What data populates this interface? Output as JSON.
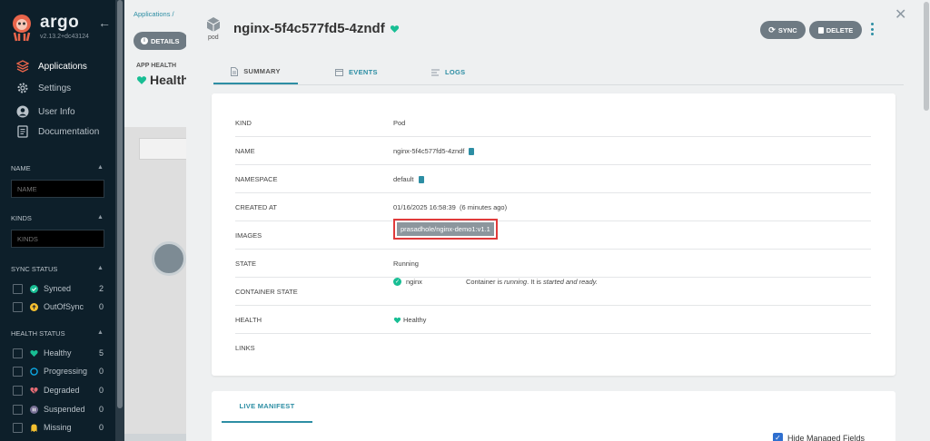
{
  "sidebar": {
    "brand": "argo",
    "version": "v2.13.2+dc43124",
    "nav": [
      {
        "label": "Applications",
        "icon": "layers-icon",
        "active": true
      },
      {
        "label": "Settings",
        "icon": "gear-icon"
      },
      {
        "label": "User Info",
        "icon": "user-icon"
      },
      {
        "label": "Documentation",
        "icon": "book-icon"
      }
    ],
    "name_title": "NAME",
    "name_placeholder": "NAME",
    "kinds_title": "KINDS",
    "kinds_placeholder": "KINDS",
    "sync_title": "SYNC STATUS",
    "sync_items": [
      {
        "label": "Synced",
        "count": "2",
        "icon": "check-circle-icon",
        "color": "#18be94"
      },
      {
        "label": "OutOfSync",
        "count": "0",
        "icon": "arrow-up-circle-icon",
        "color": "#f4c030"
      }
    ],
    "health_title": "HEALTH STATUS",
    "health_items": [
      {
        "label": "Healthy",
        "count": "5",
        "icon": "heart-icon",
        "color": "#18be94"
      },
      {
        "label": "Progressing",
        "count": "0",
        "icon": "circle-notch-icon",
        "color": "#0dadea"
      },
      {
        "label": "Degraded",
        "count": "0",
        "icon": "broken-heart-icon",
        "color": "#e96d76"
      },
      {
        "label": "Suspended",
        "count": "0",
        "icon": "pause-circle-icon",
        "color": "#766f94"
      },
      {
        "label": "Missing",
        "count": "0",
        "icon": "ghost-icon",
        "color": "#f4c030"
      }
    ]
  },
  "background": {
    "breadcrumb": "Applications /",
    "details_btn": "DETAILS",
    "app_health_label": "APP HEALTH",
    "app_health_value": "Health"
  },
  "panel": {
    "kind_icon_label": "pod",
    "title": "nginx-5f4c577fd5-4zndf",
    "sync_btn": "SYNC",
    "delete_btn": "DELETE",
    "tabs": [
      {
        "label": "SUMMARY",
        "active": true
      },
      {
        "label": "EVENTS"
      },
      {
        "label": "LOGS"
      }
    ],
    "rows": {
      "kind": {
        "key": "KIND",
        "value": "Pod"
      },
      "name": {
        "key": "NAME",
        "value": "nginx-5f4c577fd5-4zndf"
      },
      "namespace": {
        "key": "NAMESPACE",
        "value": "default"
      },
      "created": {
        "key": "CREATED AT",
        "value": "01/16/2025 16:58:39  (6 minutes ago)"
      },
      "images": {
        "key": "IMAGES",
        "value": "prasadhole/nginx-demo1:v1.1"
      },
      "state": {
        "key": "STATE",
        "value": "Running"
      },
      "container_state": {
        "key": "CONTAINER STATE",
        "container": "nginx",
        "msg_a": "Container is ",
        "msg_b": "running",
        "msg_c": ". It is ",
        "msg_d": "started and ready."
      },
      "health": {
        "key": "HEALTH",
        "value": "Healthy"
      },
      "links": {
        "key": "LINKS",
        "value": ""
      }
    },
    "live_manifest": "LIVE MANIFEST",
    "hide_managed": "Hide Managed Fields"
  },
  "colors": {
    "accent": "#2d8ea4",
    "healthy": "#18be94",
    "highlight": "#e03a3a"
  }
}
